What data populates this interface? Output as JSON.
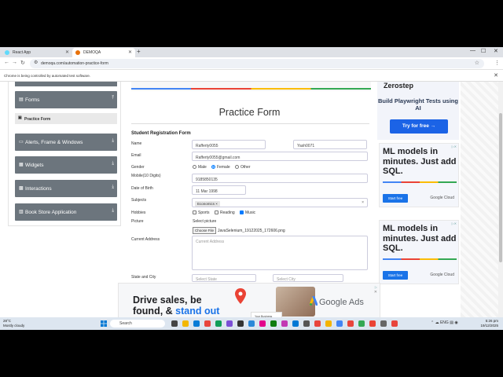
{
  "browser": {
    "tabs": [
      {
        "label": "React App",
        "color": "#61dafb"
      },
      {
        "label": "DEMOQA",
        "color": "#e8710a"
      }
    ],
    "url": "demoqa.com/automation-practice-form",
    "automation_notice": "Chrome is being controlled by automated test software."
  },
  "sidebar": {
    "groups": [
      {
        "label": "Forms",
        "chevron": "⌃"
      },
      {
        "label": "Alerts, Frame & Windows",
        "chevron": "⌄"
      },
      {
        "label": "Widgets",
        "chevron": "⌄"
      },
      {
        "label": "Interactions",
        "chevron": "⌄"
      },
      {
        "label": "Book Store Application",
        "chevron": "⌄"
      }
    ],
    "active_item": "Practice Form"
  },
  "form": {
    "title": "Practice Form",
    "section": "Student Registration Form",
    "labels": {
      "name": "Name",
      "email": "Email",
      "gender": "Gender",
      "mobile": "Mobile(10 Digits)",
      "dob": "Date of Birth",
      "subjects": "Subjects",
      "hobbies": "Hobbies",
      "picture": "Picture",
      "address": "Current Address",
      "state_city": "State and City"
    },
    "first_name": "Rafferty0055",
    "last_name": "Yash0071",
    "email": "Rafferty0055@gmail.com",
    "genders": [
      "Male",
      "Female",
      "Other"
    ],
    "gender_selected": 1,
    "mobile": "9185850135",
    "dob": "11 Mar 1998",
    "subject_chip": "Economics",
    "hobbies": [
      "Sports",
      "Reading",
      "Music"
    ],
    "hobbies_checked": [
      2
    ],
    "picture_label": "Select picture",
    "file_button": "Choose File",
    "file_name": "JavaSelenium_19122025_172606.png",
    "address_placeholder": "Current Address",
    "state_placeholder": "Select State",
    "city_placeholder": "Select City"
  },
  "ads": {
    "top": {
      "brand": "Zerostep",
      "headline": "Build Playwright Tests using AI",
      "cta": "Try for free →"
    },
    "gcloud": {
      "headline": "ML models in minutes. Just add SQL.",
      "cta": "Start free",
      "vendor": "Google Cloud"
    },
    "bottom": {
      "line1": "Drive sales, be",
      "line2a": "found, & ",
      "line2b": "stand out",
      "badge": "Your Business",
      "brand": "Google Ads"
    }
  },
  "taskbar": {
    "temp": "28°C",
    "condition": "Mostly cloudy",
    "search": "Search",
    "lang": "ENG",
    "region": "US",
    "time": "5:26 pm",
    "date": "19/12/2025"
  }
}
